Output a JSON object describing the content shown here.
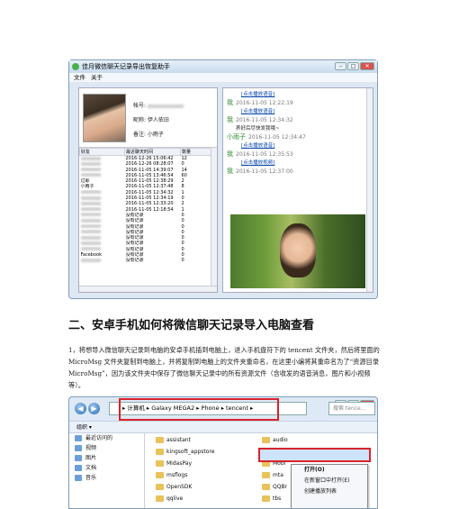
{
  "app_window": {
    "title": "佳月微信聊天记录导出恢复助手",
    "menu": [
      "文件",
      "关于"
    ],
    "profile": {
      "account_label": "帐号:",
      "nickname_label": "昵称: 伊人依旧",
      "remark_label": "备注: 小雨子"
    },
    "table": {
      "headers": [
        "好友",
        "最近聊天时间",
        "数量"
      ],
      "rows": [
        {
          "name": "",
          "time": "2016-12-26 15:06:42",
          "count": "12"
        },
        {
          "name": "",
          "time": "2016-12-26 08:28:07",
          "count": "0"
        },
        {
          "name": "",
          "time": "2016-11-05 14:39:07",
          "count": "14"
        },
        {
          "name": "",
          "time": "2016-11-05 13:46:54",
          "count": "60"
        },
        {
          "name": "过耶",
          "time": "2016-11-05 12:38:29",
          "count": "2"
        },
        {
          "name": "小雨子",
          "time": "2016-11-05 12:37:48",
          "count": "8"
        },
        {
          "name": "",
          "time": "2016-11-05 12:34:32",
          "count": "1"
        },
        {
          "name": "",
          "time": "2016-11-05 12:34:19",
          "count": "0"
        },
        {
          "name": "",
          "time": "2016-11-05 12:33:20",
          "count": "2"
        },
        {
          "name": "",
          "time": "2016-11-05 12:18:54",
          "count": "1"
        },
        {
          "name": "",
          "time": "没有记录",
          "count": "0"
        },
        {
          "name": "",
          "time": "没有记录",
          "count": "0"
        },
        {
          "name": "",
          "time": "没有记录",
          "count": "0"
        },
        {
          "name": "",
          "time": "没有记录",
          "count": "0"
        },
        {
          "name": "",
          "time": "没有记录",
          "count": "0"
        },
        {
          "name": "",
          "time": "没有记录",
          "count": "0"
        },
        {
          "name": "",
          "time": "没有记录",
          "count": "0"
        },
        {
          "name": "Facebook",
          "time": "没有记录",
          "count": "0"
        },
        {
          "name": "",
          "time": "没有记录",
          "count": "0"
        }
      ]
    },
    "chat": [
      {
        "type": "link",
        "text": "[点击播放语音]"
      },
      {
        "type": "who",
        "name": "我",
        "time": "2016-11-05 12:22:19"
      },
      {
        "type": "link",
        "text": "[点击播放语音]"
      },
      {
        "type": "who",
        "name": "我",
        "time": "2016-11-05 12:34:32"
      },
      {
        "type": "text",
        "text": "养好后尽快发我哦~"
      },
      {
        "type": "who",
        "name": "小雨子",
        "time": "2016-11-05 12:34:47"
      },
      {
        "type": "link",
        "text": "[点击播放语音]"
      },
      {
        "type": "who",
        "name": "我",
        "time": "2016-11-05 12:35:53"
      },
      {
        "type": "link",
        "text": "[点击播放视频]"
      },
      {
        "type": "who",
        "name": "我",
        "time": "2016-11-05 12:37:00"
      }
    ]
  },
  "article": {
    "heading": "二、安卓手机如何将微信聊天记录导入电脑查看",
    "paragraph": "1，将想导入微信聊天记录到电脑的安卓手机插到电脑上，进入手机盘符下的 tencent 文件夹，然后将里面的 MicroMsg 文件夹复制到电脑上，并将复制到电脑上的文件夹重命名，在这里小编将其重命名为了“资源目录 MicroMsg”，因为该文件夹中保存了微信聊天记录中的所有资源文件（含收发的语音消息，图片和小视频等）。"
  },
  "explorer": {
    "breadcrumb": "▸ 计算机 ▸ Galaxy MEGA2 ▸ Phone ▸ tencent ▸",
    "search_placeholder": "搜索 tence...",
    "organize": "组织 ▾",
    "nav_items": [
      "最近访问的",
      "视频",
      "图片",
      "文档",
      "音乐"
    ],
    "folders_col1": [
      "assistant",
      "kingsoft_appstore",
      "MidasPay",
      "msflogs",
      "OpenSDK",
      "qqlive"
    ],
    "folders_col2": [
      "audio",
      "MicroMsg",
      "Mobi",
      "mta",
      "QQBr",
      "tbs"
    ],
    "context_menu": [
      "打开(O)",
      "在新窗口中打开(E)",
      "创建播放列表"
    ]
  }
}
